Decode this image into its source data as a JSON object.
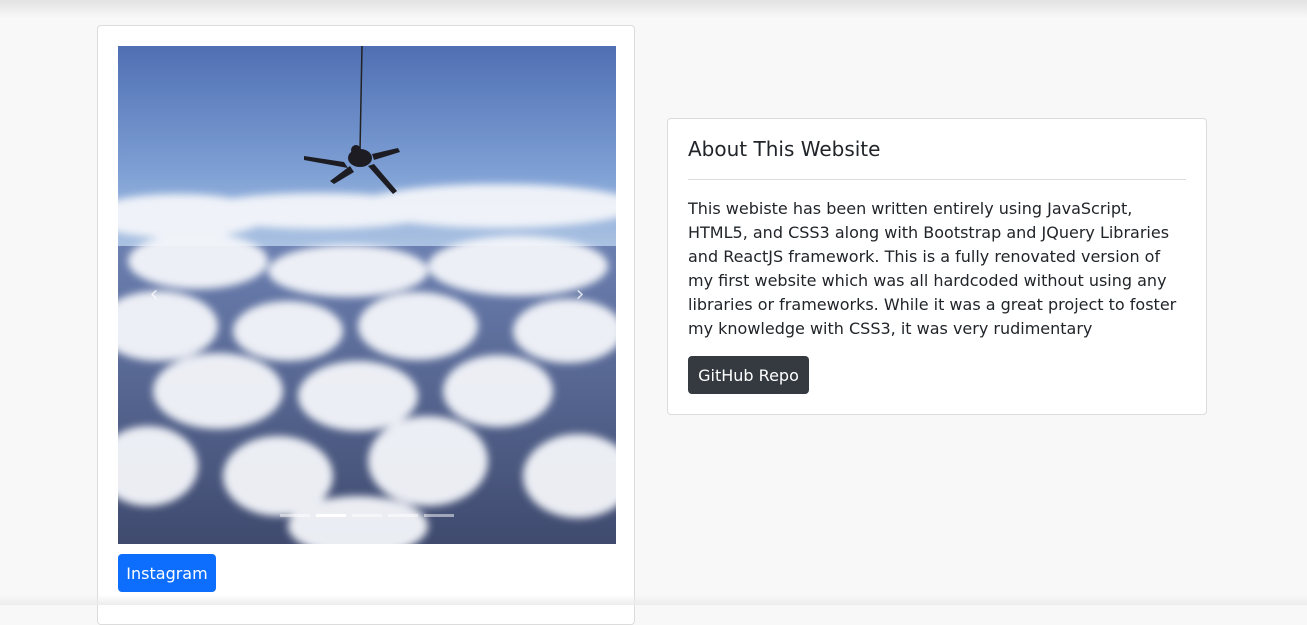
{
  "carousel": {
    "image": "skydiver-above-clouds",
    "prev_icon": "chevron-left-icon",
    "next_icon": "chevron-right-icon",
    "prev_glyph": "‹",
    "next_glyph": "›",
    "slide_count": 5,
    "active_slide": 2
  },
  "instagram": {
    "label": "Instagram",
    "color": "#0d6efd"
  },
  "about": {
    "title": "About This Website",
    "text": "This webiste has been written entirely using JavaScript, HTML5, and CSS3 along with Bootstrap and JQuery Libraries and ReactJS framework. This is a fully renovated version of my first website which was all hardcoded without using any libraries or frameworks. While it was a great project to foster my knowledge with CSS3, it was very rudimentary",
    "button_label": "GitHub Repo",
    "button_color": "#343a40"
  }
}
